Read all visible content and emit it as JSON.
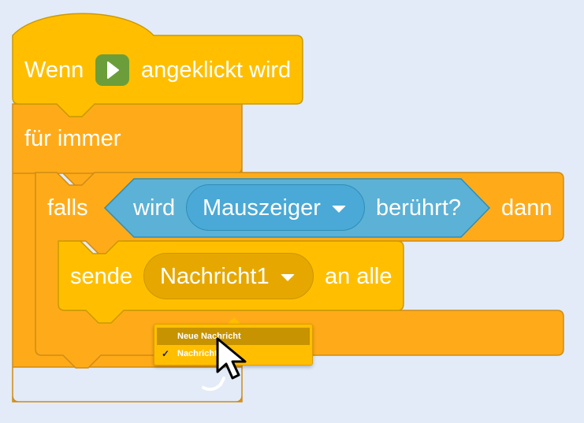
{
  "hat_block": {
    "when": "Wenn",
    "clicked": "angeklickt wird",
    "flag_icon": "green-flag-icon"
  },
  "forever_block": {
    "label": "für immer"
  },
  "if_block": {
    "if_label": "falls",
    "then_label": "dann"
  },
  "sensing_block": {
    "touching_prefix": "wird",
    "target": "Mauszeiger",
    "touching_suffix": "berührt?"
  },
  "broadcast_block": {
    "send_label": "sende",
    "message": "Nachricht1",
    "to_all": "an alle"
  },
  "dropdown_menu": {
    "items": [
      {
        "label": "Neue Nachricht",
        "checked": false
      },
      {
        "label": "Nachricht1",
        "checked": true
      }
    ],
    "check_mark": "✓"
  },
  "colors": {
    "events": "#ffbf00",
    "control": "#ffab19",
    "sensing": "#5cb1d6",
    "flag": "#6b9e3a"
  }
}
